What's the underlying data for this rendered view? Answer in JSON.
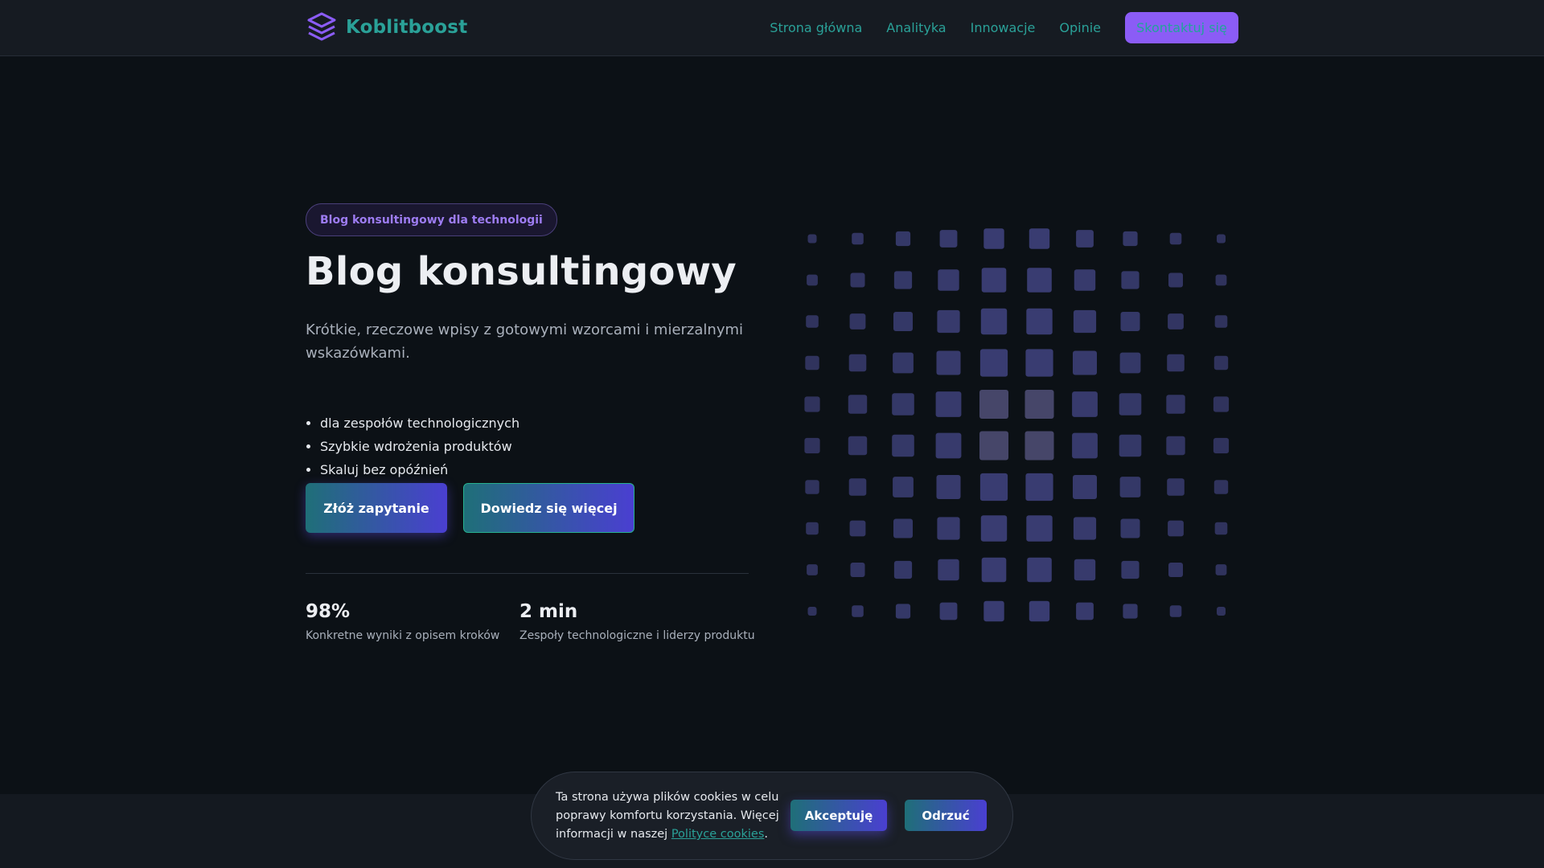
{
  "brand": {
    "name": "Koblitboost",
    "color": "#2aa198",
    "icon": "stacked-layers-icon"
  },
  "nav": {
    "items": [
      "Strona główna",
      "Analityka",
      "Innowacje",
      "Opinie"
    ],
    "cta": "Skontaktuj się"
  },
  "hero": {
    "badge": "Blog konsultingowy dla technologii",
    "title": "Blog konsultingowy",
    "subtitle": "Krótkie, rzeczowe wpisy z gotowymi wzorcami i mierzalnymi wskazówkami.",
    "features": [
      "dla zespołów technologicznych",
      "Szybkie wdrożenia produktów",
      "Skaluj bez opóźnień"
    ],
    "primary_button": "Złóż zapytanie",
    "secondary_button": "Dowiedz się więcej"
  },
  "stats": [
    {
      "value": "98%",
      "label": "Konkretne wyniki z opisem kroków"
    },
    {
      "value": "2 min",
      "label": "Zespoły technologiczne i liderzy produktu"
    }
  ],
  "cookie": {
    "text_before": "Ta strona używa plików cookies w celu poprawy komfortu korzystania. Więcej informacji w naszej ",
    "link": "Polityce cookies",
    "text_after": ".",
    "accept": "Akceptuję",
    "reject": "Odrzuć"
  },
  "colors": {
    "accent_violet": "#8b5cf6",
    "accent_teal": "#2aa198",
    "grid_square": "#3c3f76",
    "grid_square_light": "#4a4a6e"
  }
}
